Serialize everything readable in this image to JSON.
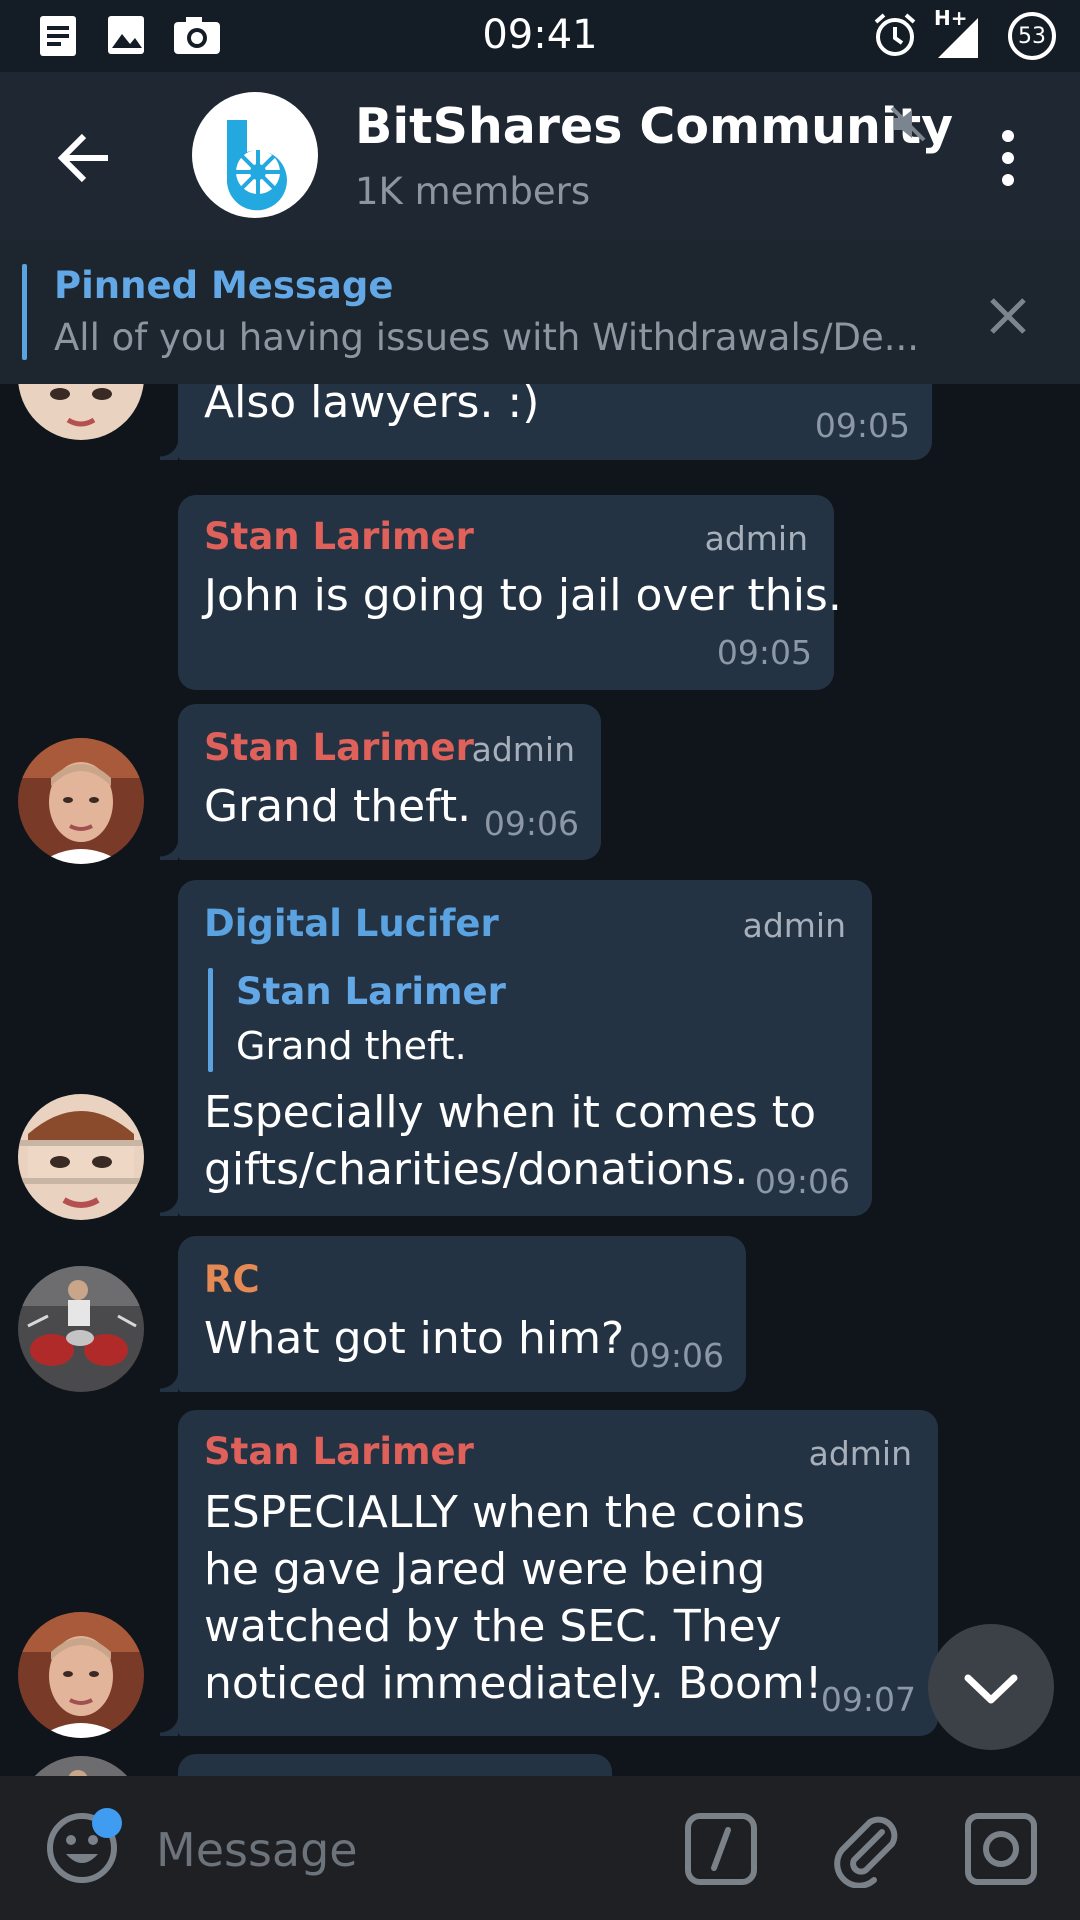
{
  "status_bar": {
    "time": "09:41",
    "battery": "53",
    "network": "H+"
  },
  "header": {
    "title": "BitShares Community",
    "subtitle": "1K members"
  },
  "pinned": {
    "title": "Pinned Message",
    "text": "All of you having issues with Withdrawals/De..."
  },
  "messages": [
    {
      "text": "Also lawyers. :)",
      "time": "09:05"
    },
    {
      "sender": "Stan Larimer",
      "badge": "admin",
      "text": "John is going to jail over this.",
      "time": "09:05"
    },
    {
      "sender": "Stan Larimer",
      "badge": "admin",
      "text": "Grand theft.",
      "time": "09:06"
    },
    {
      "sender": "Digital Lucifer",
      "badge": "admin",
      "reply": {
        "name": "Stan Larimer",
        "text": "Grand theft."
      },
      "text_lines": [
        "Especially when it comes to",
        "gifts/charities/donations."
      ],
      "time": "09:06"
    },
    {
      "sender": "RC",
      "text": "What got into him?",
      "time": "09:06"
    },
    {
      "sender": "Stan Larimer",
      "badge": "admin",
      "text_lines": [
        "ESPECIALLY when the coins",
        "he gave Jared were being",
        "watched by the SEC.  They",
        "noticed immediately.  Boom!"
      ],
      "time": "09:07"
    }
  ],
  "input": {
    "placeholder": "Message"
  },
  "colors": {
    "stan": "#e0605a",
    "lucifer": "#5aa2e0",
    "rc": "#e68a55",
    "bubble": "#243344",
    "background": "#10151b"
  }
}
